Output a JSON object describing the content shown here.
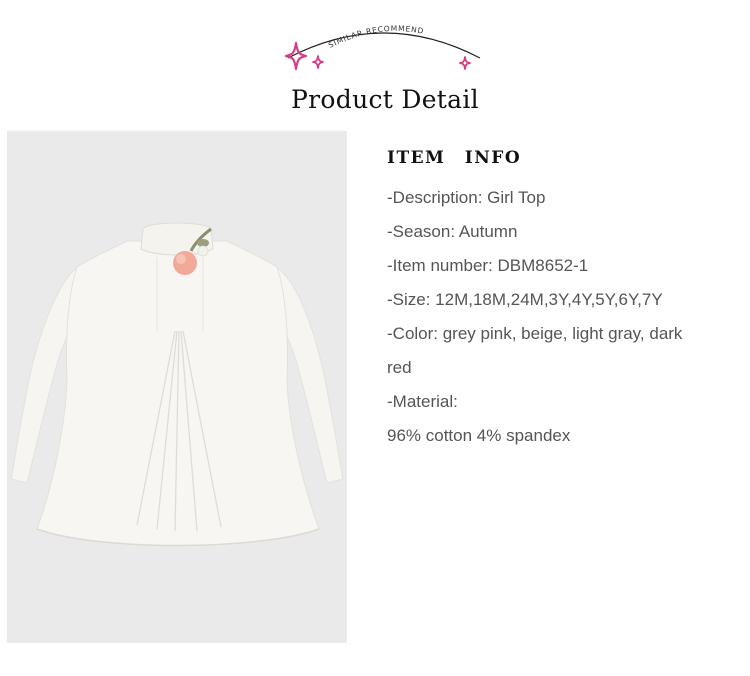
{
  "banner": {
    "arc_text": "SIMILAR  RECOMMEND",
    "sparkle_icon": "sparkle-icon",
    "accent_color": "#d63d84"
  },
  "page_title": "Product Detail",
  "item_info": {
    "heading": "ITEM INFO",
    "lines": [
      "-Description: Girl Top",
      "-Season: Autumn",
      "-Item number: DBM8652-1",
      "-Size: 12M,18M,24M,3Y,4Y,5Y,6Y,7Y",
      "-Color: grey pink, beige, light gray, dark",
      "red",
      "-Material:",
      "96% cotton 4% spandex"
    ]
  },
  "product_image": {
    "subject": "white long-sleeve girl top with pink flower brooch",
    "background_color": "#ececec",
    "garment_color": "#f7f6f2",
    "brooch_color": "#f2a99a"
  }
}
